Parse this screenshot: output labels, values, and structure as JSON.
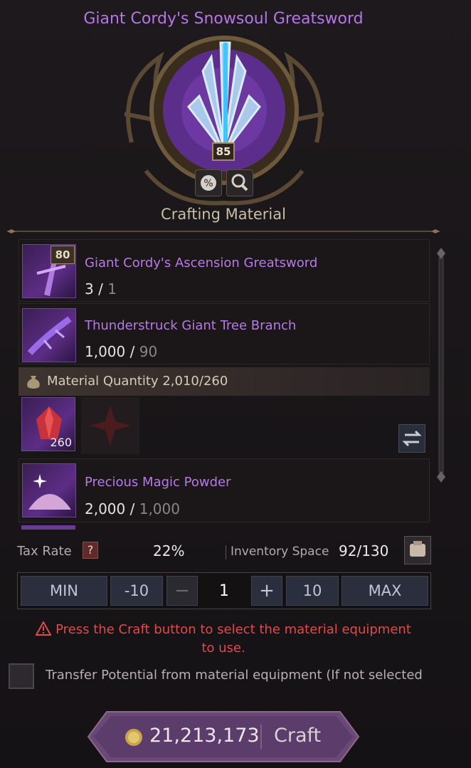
{
  "item": {
    "name": "Giant Cordy's Snowsoul Greatsword",
    "level": "85"
  },
  "section_title": "Crafting Material",
  "materials": [
    {
      "name": "Giant Cordy's Ascension Greatsword",
      "have": "3",
      "need": "1",
      "level": "80"
    },
    {
      "name": "Thunderstruck Giant Tree Branch",
      "have": "1,000",
      "need": "90"
    },
    {
      "name": "Precious Magic Powder",
      "have": "2,000",
      "need": "1,000"
    }
  ],
  "material_quantity": "Material Quantity 2,010/260",
  "gem_count": "260",
  "tax": {
    "label": "Tax Rate",
    "help": "?",
    "value": "22%"
  },
  "inventory": {
    "label": "Inventory Space",
    "value": "92/130"
  },
  "stepper": {
    "min": "MIN",
    "minus10": "-10",
    "minus": "−",
    "value": "1",
    "plus": "+",
    "plus10": "10",
    "max": "MAX"
  },
  "warning": {
    "line1": "Press the Craft button to select the material equipment",
    "line2": "to use."
  },
  "transfer_text": "Transfer Potential from material equipment (If not selected",
  "footer": {
    "price": "21,213,173",
    "craft": "Craft"
  },
  "icons": [
    "percent-icon",
    "magnifier-icon",
    "swap-icon",
    "bag-icon",
    "coin-icon",
    "warning-icon",
    "inventory-icon"
  ]
}
